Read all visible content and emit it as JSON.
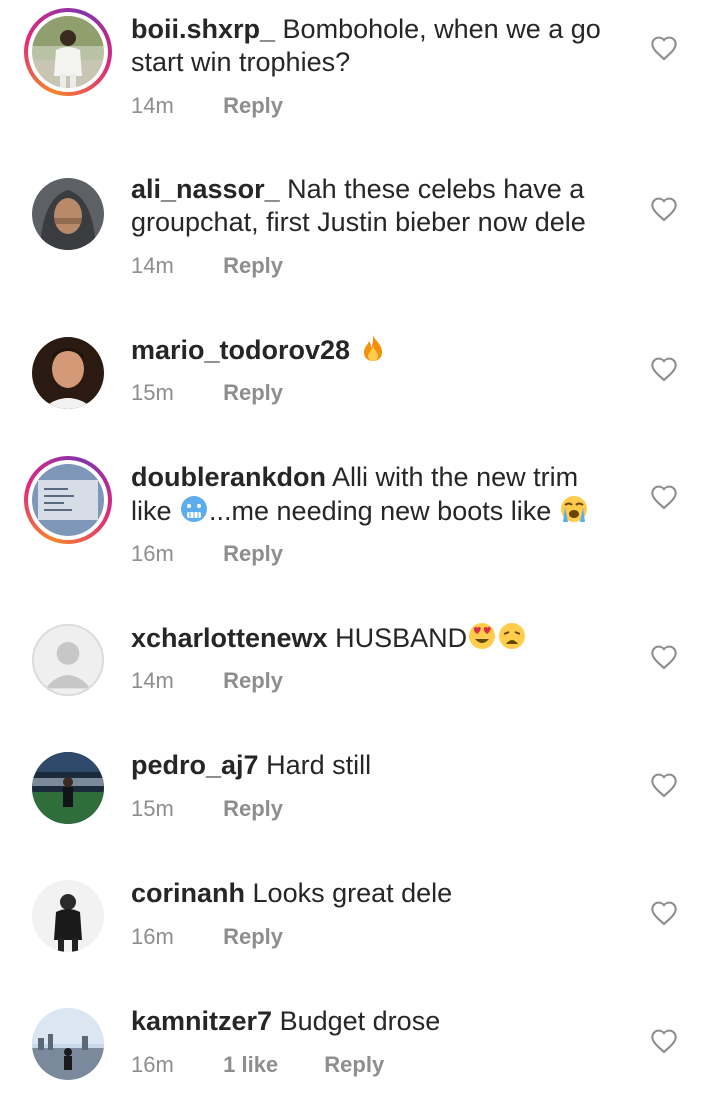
{
  "comments": [
    {
      "username": "boii.shxrp_",
      "text": "Bombohole, when we a go",
      "text2": "start win trophies?",
      "time": "14m",
      "reply": "Reply",
      "has_story_ring": true
    },
    {
      "username": "ali_nassor_",
      "text": "Nah these celebs have a",
      "text2": "groupchat, first Justin bieber now dele",
      "time": "14m",
      "reply": "Reply",
      "has_story_ring": false
    },
    {
      "username": "mario_todorov28",
      "text": "",
      "emoji": "fire",
      "time": "15m",
      "reply": "Reply",
      "has_story_ring": false
    },
    {
      "username": "doublerankdon",
      "text": "Alli with the new trim",
      "text2a": "like",
      "text2b": "...me needing new boots like",
      "emoji_a": "cold-face",
      "emoji_b": "loudly-crying-face",
      "time": "16m",
      "reply": "Reply",
      "has_story_ring": true
    },
    {
      "username": "xcharlottenewx",
      "text": "HUSBAND",
      "emoji_a": "heart-eyes",
      "emoji_b": "weary-face",
      "time": "14m",
      "reply": "Reply",
      "has_story_ring": false
    },
    {
      "username": "pedro_aj7",
      "text": "Hard still",
      "time": "15m",
      "reply": "Reply",
      "has_story_ring": false
    },
    {
      "username": "corinanh",
      "text": "Looks great dele",
      "time": "16m",
      "reply": "Reply",
      "has_story_ring": false
    },
    {
      "username": "kamnitzer7",
      "text": "Budget drose",
      "time": "16m",
      "likes": "1 like",
      "reply": "Reply",
      "has_story_ring": false
    }
  ],
  "colors": {
    "primary_text": "#262626",
    "secondary_text": "#8e8e8e",
    "heart_outline": "#8e8e8e",
    "story_ring_start": "#f58529",
    "story_ring_end": "#dd2a7b"
  }
}
